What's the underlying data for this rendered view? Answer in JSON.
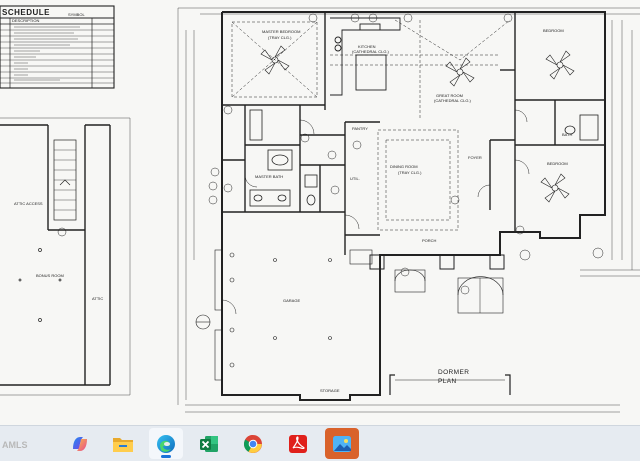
{
  "schedule": {
    "title": "SCHEDULE",
    "col_description": "DESCRIPTION",
    "col_symbol": "SYMBOL"
  },
  "rooms": {
    "master_bedroom": "MASTER BEDROOM",
    "master_bedroom_note": "(TRAY CLG.)",
    "kitchen": "KITCHEN",
    "kitchen_note": "(CATHEDRAL CLG.)",
    "great_room": "GREAT ROOM",
    "great_room_note": "(CATHEDRAL CLG.)",
    "bedroom_1": "BEDROOM",
    "bedroom_2": "BEDROOM",
    "bath": "BATH",
    "pantry": "PANTRY",
    "dining_room": "DINING ROOM",
    "dining_note": "(TRAY CLG.)",
    "foyer": "FOYER",
    "util": "UTIL.",
    "master_bath": "MASTER BATH",
    "porch": "PORCH",
    "garage": "GARAGE",
    "storage": "STORAGE",
    "bonus_room": "BONUS ROOM",
    "dormer": "DORMER",
    "plan": "PLAN",
    "attic_access": "ATTIC ACCESS",
    "attic": "ATTIC"
  },
  "taskbar": {
    "watermark": "AMLS",
    "apps": [
      {
        "name": "Copilot",
        "icon": "copilot-icon"
      },
      {
        "name": "File Explorer",
        "icon": "folder-icon"
      },
      {
        "name": "Microsoft Edge",
        "icon": "edge-icon"
      },
      {
        "name": "Excel",
        "icon": "excel-icon"
      },
      {
        "name": "Google Chrome",
        "icon": "chrome-icon"
      },
      {
        "name": "Adobe Acrobat",
        "icon": "acrobat-icon"
      },
      {
        "name": "Photos",
        "icon": "photos-icon"
      }
    ]
  },
  "colors": {
    "taskbar_bg": "#e6ebf1",
    "active_indicator": "#1a73d9",
    "selected_app": "#d9622b"
  }
}
